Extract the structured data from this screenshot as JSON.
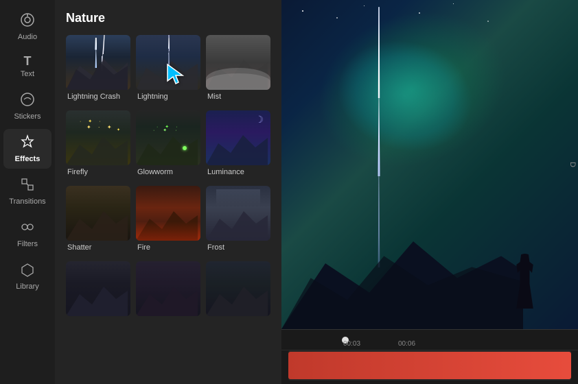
{
  "sidebar": {
    "items": [
      {
        "id": "audio",
        "label": "Audio",
        "icon": "♻"
      },
      {
        "id": "text",
        "label": "Text",
        "icon": "T"
      },
      {
        "id": "stickers",
        "label": "Stickers",
        "icon": "©"
      },
      {
        "id": "effects",
        "label": "Effects",
        "icon": "✦",
        "active": true
      },
      {
        "id": "transitions",
        "label": "Transitions",
        "icon": "⊠"
      },
      {
        "id": "filters",
        "label": "Filters",
        "icon": "❋"
      },
      {
        "id": "library",
        "label": "Library",
        "icon": "⬡"
      }
    ]
  },
  "effects_panel": {
    "title": "Nature",
    "effects": [
      {
        "id": "lightning-crash",
        "label": "Lightning Crash",
        "thumb_class": "thumb-lightning-crash"
      },
      {
        "id": "lightning",
        "label": "Lightning",
        "thumb_class": "thumb-lightning"
      },
      {
        "id": "mist",
        "label": "Mist",
        "thumb_class": "thumb-mist"
      },
      {
        "id": "firefly",
        "label": "Firefly",
        "thumb_class": "thumb-firefly"
      },
      {
        "id": "glowworm",
        "label": "Glowworm",
        "thumb_class": "thumb-glowworm"
      },
      {
        "id": "luminance",
        "label": "Luminance",
        "thumb_class": "thumb-luminance"
      },
      {
        "id": "shatter",
        "label": "Shatter",
        "thumb_class": "thumb-shatter"
      },
      {
        "id": "fire",
        "label": "Fire",
        "thumb_class": "thumb-fire"
      },
      {
        "id": "frost",
        "label": "Frost",
        "thumb_class": "thumb-frost"
      },
      {
        "id": "bottom1",
        "label": "",
        "thumb_class": "thumb-bottom1"
      },
      {
        "id": "bottom2",
        "label": "",
        "thumb_class": "thumb-bottom2"
      },
      {
        "id": "bottom3",
        "label": "",
        "thumb_class": "thumb-bottom3"
      }
    ]
  },
  "timeline": {
    "markers": [
      "00:03",
      "00:06"
    ],
    "current_time": "00:03"
  }
}
